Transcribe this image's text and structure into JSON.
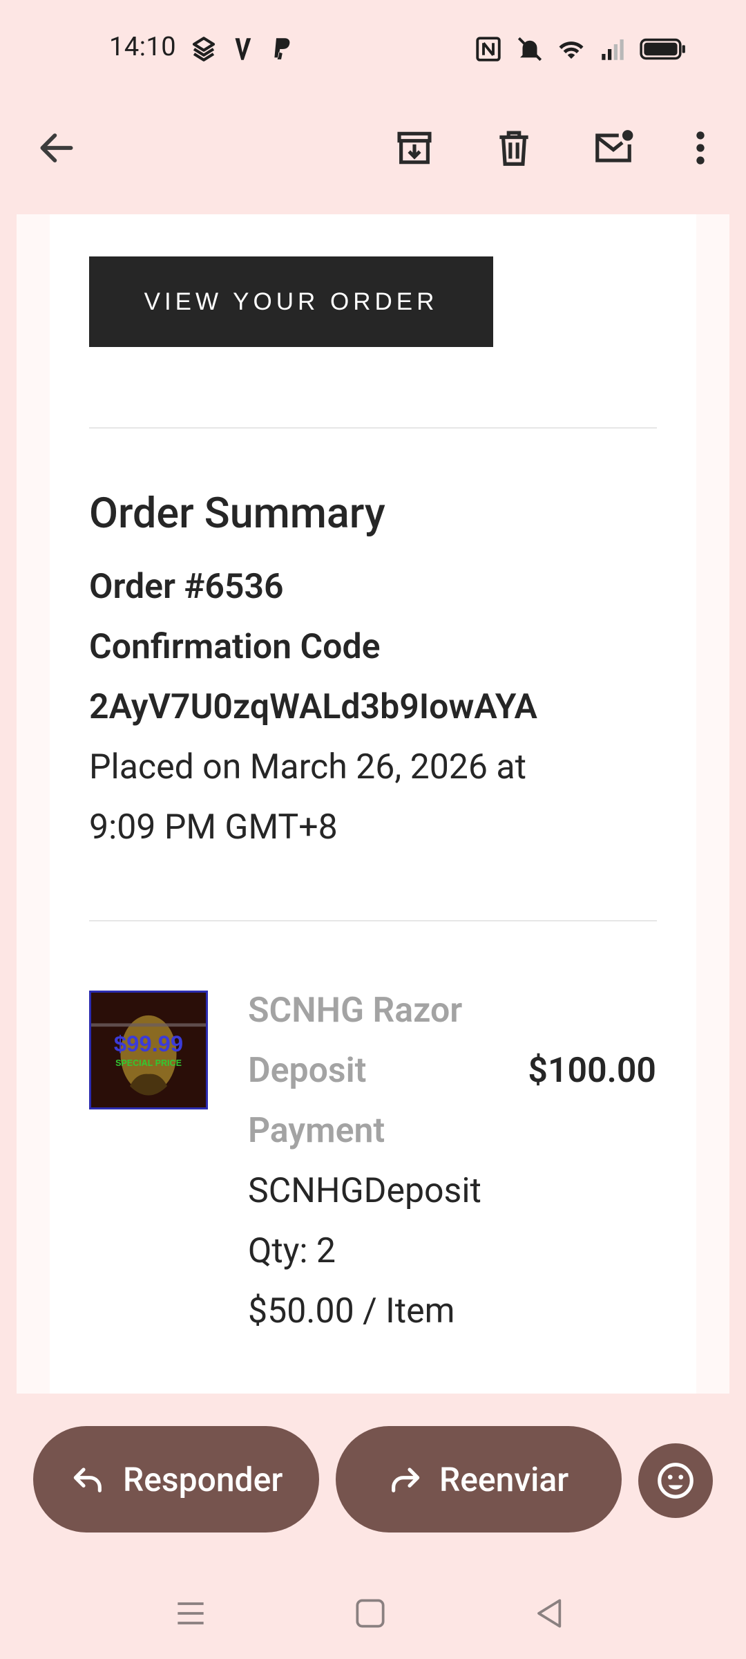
{
  "status_bar": {
    "time": "14:10",
    "left_icons": [
      "layers-app-icon",
      "v-app-icon",
      "paypal-icon"
    ],
    "right_icons": [
      "nfc-icon",
      "vibrate-off-icon",
      "wifi-icon",
      "signal-icon",
      "battery-icon"
    ]
  },
  "app_bar": {
    "back_icon": "arrow-back-icon",
    "actions": [
      "archive-icon",
      "delete-icon",
      "mark-unread-icon",
      "more-vert-icon"
    ]
  },
  "email": {
    "view_order_button": "VIEW YOUR ORDER",
    "summary_title": "Order Summary",
    "order_number": "Order #6536",
    "confirmation_label": "Confirmation Code",
    "confirmation_code": "2AyV7U0zqWALd3b9IowAYA",
    "placed_line1": "Placed on March 26, 2026 at",
    "placed_line2": "9:09 PM GMT+8",
    "product": {
      "thumb_price": "$99.99",
      "thumb_caption": "SPECIAL PRICE",
      "name_line1": "SCNHG Razor",
      "name_line2": "Deposit",
      "name_line3": "Payment",
      "price": "$100.00",
      "sku": "SCNHGDeposit",
      "qty": "Qty: 2",
      "unit_price": "$50.00 / Item"
    }
  },
  "actions": {
    "reply_label": "Responder",
    "forward_label": "Reenviar",
    "emoji_icon": "emoji-reaction-icon"
  },
  "nav_bar": [
    "menu-nav-icon",
    "home-nav-icon",
    "back-nav-icon"
  ],
  "colors": {
    "background": "#fde6e4",
    "button_dark": "#262626",
    "action_pill": "#76544e",
    "muted_text": "#a3a3a3"
  }
}
